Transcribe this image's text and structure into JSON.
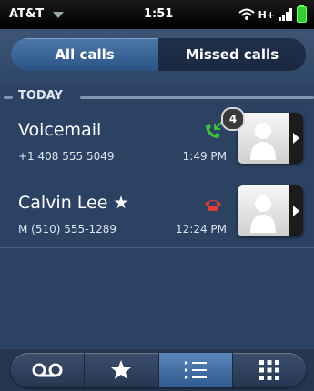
{
  "status_bar": {
    "carrier": "AT&T",
    "time": "1:51",
    "network": "H+"
  },
  "segmented_tabs": [
    {
      "label": "All calls",
      "selected": true
    },
    {
      "label": "Missed calls",
      "selected": false
    }
  ],
  "section": {
    "title": "TODAY"
  },
  "calls": [
    {
      "name": "Voicemail",
      "starred": false,
      "number": "+1 408 555 5049",
      "time": "1:49 PM",
      "call_type": "incoming",
      "call_icon_color": "#3fbf3f",
      "badge": "4"
    },
    {
      "name": "Calvin Lee",
      "star": "★",
      "number": "M (510) 555-1289",
      "time": "12:24 PM",
      "call_type": "missed",
      "call_icon_color": "#e03a3a"
    }
  ],
  "toolbar": {
    "buttons": [
      {
        "name": "voicemail-icon",
        "selected": false
      },
      {
        "name": "star-icon",
        "selected": false
      },
      {
        "name": "call-list-icon",
        "selected": true
      },
      {
        "name": "dialpad-icon",
        "selected": false
      }
    ]
  },
  "colors": {
    "background": "#2b4262",
    "accent": "#3f6a9e"
  }
}
